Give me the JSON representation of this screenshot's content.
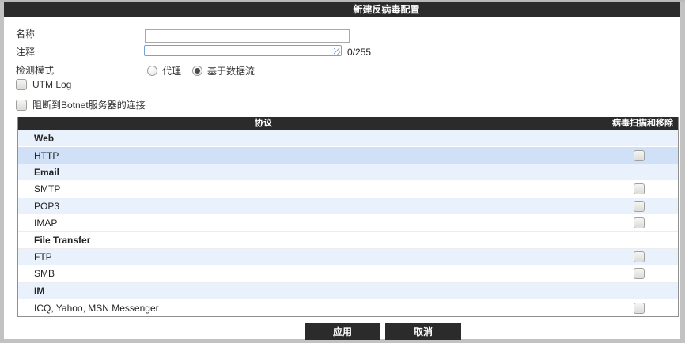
{
  "dialog": {
    "title": "新建反病毒配置"
  },
  "form": {
    "name_label": "名称",
    "name_value": "",
    "comment_label": "注释",
    "comment_value": "",
    "comment_counter": "0/255",
    "mode_label": "检测模式",
    "mode_options": [
      {
        "label": "代理",
        "selected": false
      },
      {
        "label": "基于数据流",
        "selected": true
      }
    ],
    "option_checkboxes": [
      {
        "label": "UTM Log",
        "checked": false
      },
      {
        "label": "阻断到Botnet服务器的连接",
        "checked": false
      }
    ]
  },
  "table": {
    "columns": [
      "协议",
      "病毒扫描和移除"
    ],
    "rows": [
      {
        "label": "Web",
        "type": "group",
        "checkbox": false,
        "checked": false,
        "bg": "blue"
      },
      {
        "label": "HTTP",
        "type": "item",
        "checkbox": true,
        "checked": false,
        "bg": "hl"
      },
      {
        "label": "Email",
        "type": "group",
        "checkbox": false,
        "checked": false,
        "bg": "blue"
      },
      {
        "label": "SMTP",
        "type": "item",
        "checkbox": true,
        "checked": false,
        "bg": "white"
      },
      {
        "label": "POP3",
        "type": "item",
        "checkbox": true,
        "checked": false,
        "bg": "blue"
      },
      {
        "label": "IMAP",
        "type": "item",
        "checkbox": true,
        "checked": false,
        "bg": "white"
      },
      {
        "label": "File Transfer",
        "type": "group",
        "checkbox": false,
        "checked": false,
        "bg": "white"
      },
      {
        "label": "FTP",
        "type": "item",
        "checkbox": true,
        "checked": false,
        "bg": "blue"
      },
      {
        "label": "SMB",
        "type": "item",
        "checkbox": true,
        "checked": false,
        "bg": "white"
      },
      {
        "label": "IM",
        "type": "group",
        "checkbox": false,
        "checked": false,
        "bg": "blue"
      },
      {
        "label": "ICQ, Yahoo, MSN Messenger",
        "type": "item",
        "checkbox": true,
        "checked": false,
        "bg": "white"
      }
    ]
  },
  "buttons": {
    "apply": "应用",
    "cancel": "取消"
  },
  "colors": {
    "titlebar_bg": "#2b2b2b",
    "row_blue": "#e9f1fc",
    "row_highlight": "#cfe0f7",
    "row_white": "#ffffff",
    "page_frame": "#c2c2c2",
    "focus_border": "#7aa0d8"
  }
}
